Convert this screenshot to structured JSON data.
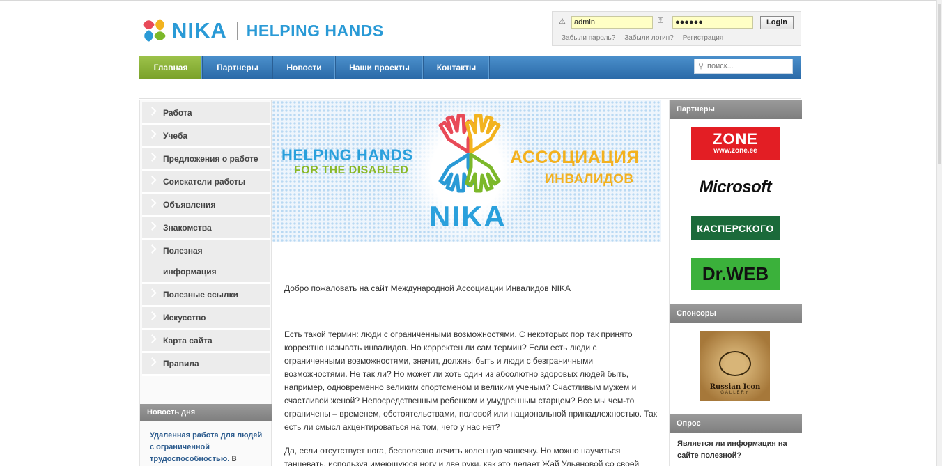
{
  "header": {
    "logo_text": "NIKA",
    "tagline": "HELPING HANDS"
  },
  "login": {
    "username_value": "admin",
    "password_value": "●●●●●●",
    "button_label": "Login",
    "links": [
      "Забыли пароль?",
      "Забыли логин?",
      "Регистрация"
    ]
  },
  "nav": {
    "items": [
      {
        "label": "Главная",
        "active": true
      },
      {
        "label": "Партнеры"
      },
      {
        "label": "Новости"
      },
      {
        "label": "Наши проекты"
      },
      {
        "label": "Контакты"
      }
    ],
    "search_placeholder": "поиск..."
  },
  "sidebar": {
    "items": [
      "Работа",
      "Учеба",
      "Предложения о работе",
      "Соискатели работы",
      "Объявления",
      "Знакомства",
      "Полезная информация",
      "Полезные ссылки",
      "Искусство",
      "Карта сайта",
      "Правила"
    ],
    "news_title": "Новость дня",
    "news_headline": "Удаленная работа для людей с ограниченной трудоспособностью.",
    "news_rest": " В"
  },
  "banner": {
    "line1": "HELPING HANDS",
    "line2": "FOR THE DISABLED",
    "ru1": "АССОЦИАЦИЯ",
    "ru2": "ИНВАЛИДОВ",
    "brand": "NIKA"
  },
  "main": {
    "welcome": "Добро пожаловать на сайт Международной Ассоциации Инвалидов NIKA",
    "paragraph1": "Есть такой термин: люди с ограниченными возможностями. С некоторых пор так принято корректно называть инвалидов. Но корректен ли сам термин? Если есть люди с ограниченными возможностями, значит, должны быть и люди с безграничными возможностями. Не так ли? Но может ли хоть один из абсолютно здоровых людей быть, например, одновременно великим спортсменом и великим ученым? Счастливым мужем и счастливой женой? Непосредственным ребенком и умудренным старцем? Все мы чем-то ограничены – временем, обстоятельствами, половой или национальной принадлежностью. Так есть ли смысл акцентироваться на том, чего у нас нет?",
    "paragraph2": "Да, если отсутствует нога, бесполезно лечить коленную чашечку. Но можно научиться танцевать, используя имеющуюся ногу и две руки, как это делает Жай Ульяновой со своей"
  },
  "right": {
    "partners_title": "Партнеры",
    "partners": {
      "zone": "ZONE",
      "zone_url": "www.zone.ee",
      "microsoft": "Microsoft",
      "kaspersky": "КАСПЕРСКОГО",
      "drweb": "Dr.WEB"
    },
    "sponsors_title": "Спонсоры",
    "sponsor_name": "Russian Icon",
    "sponsor_sub": "GALLERY",
    "poll_title": "Опрос",
    "poll_question": "Является ли информация на сайте полезной?"
  },
  "colors": {
    "nav_blue": "#2b6aa8",
    "nav_active_green": "#7aa22a",
    "brand_blue": "#2a9ad6",
    "input_yellow": "#ffffc5"
  }
}
